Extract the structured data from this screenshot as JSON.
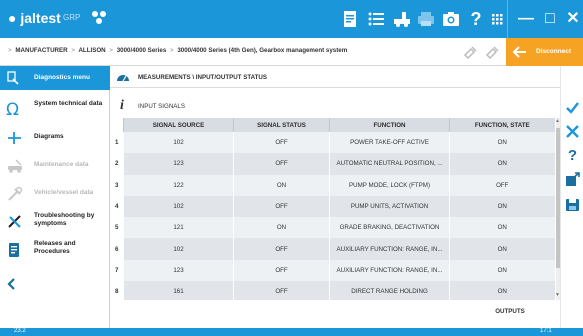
{
  "app": {
    "logo_text": "jaltest",
    "logo_sub": "GRP"
  },
  "toolbar": {
    "icons": [
      "report-icon",
      "list-icon",
      "truck-icon",
      "printer-icon",
      "camera-icon",
      "help-icon",
      "apps-grid-icon"
    ],
    "window_buttons": {
      "minimize": "—",
      "maximize": "□",
      "close": "✕"
    }
  },
  "breadcrumb": {
    "items": [
      "MANUFACTURER",
      "ALLISON",
      "3000/4000 Series",
      "3000/4000 Series (4th Gen), Gearbox management system"
    ],
    "separator": ">"
  },
  "disconnect": {
    "label": "Disconnect"
  },
  "sidebar": {
    "header": "Diagnostics menu",
    "items": [
      {
        "label": "System technical data",
        "icon": "omega-icon",
        "enabled": true
      },
      {
        "label": "Diagrams",
        "icon": "diagram-icon",
        "enabled": true
      },
      {
        "label": "Maintenance data",
        "icon": "wrench-car-icon",
        "enabled": false
      },
      {
        "label": "Vehicle/vessel data",
        "icon": "tools-icon",
        "enabled": false
      },
      {
        "label": "Troubleshooting by symptoms",
        "icon": "troubleshoot-icon",
        "enabled": true
      },
      {
        "label": "Releases and Procedures",
        "icon": "procedures-icon",
        "enabled": true
      }
    ]
  },
  "main": {
    "title": "MEASUREMENTS \\ INPUT/OUTPUT STATUS",
    "section": {
      "icon_glyph": "i",
      "label": "INPUT SIGNALS"
    },
    "table": {
      "headers": [
        "SIGNAL SOURCE",
        "SIGNAL STATUS",
        "FUNCTION",
        "FUNCTION, STATE"
      ],
      "rows": [
        {
          "num": "1",
          "source": "102",
          "status": "OFF",
          "function": "POWER TAKE-OFF ACTIVE",
          "state": "ON"
        },
        {
          "num": "2",
          "source": "123",
          "status": "OFF",
          "function": "AUTOMATIC NEUTRAL POSITION, ...",
          "state": "ON"
        },
        {
          "num": "3",
          "source": "122",
          "status": "ON",
          "function": "PUMP MODE, LOCK (FTPM)",
          "state": "OFF"
        },
        {
          "num": "4",
          "source": "102",
          "status": "OFF",
          "function": "PUMP UNITS, ACTIVATION",
          "state": "ON"
        },
        {
          "num": "5",
          "source": "121",
          "status": "ON",
          "function": "GRADE BRAKING, DEACTIVATION",
          "state": "ON"
        },
        {
          "num": "6",
          "source": "102",
          "status": "OFF",
          "function": "AUXILIARY FUNCTION: RANGE, IN...",
          "state": "ON"
        },
        {
          "num": "7",
          "source": "123",
          "status": "OFF",
          "function": "AUXILIARY FUNCTION: RANGE, IN...",
          "state": "ON"
        },
        {
          "num": "8",
          "source": "161",
          "status": "OFF",
          "function": "DIRECT RANGE HOLDING",
          "state": "ON"
        }
      ]
    },
    "outputs_label": "OUTPUTS"
  },
  "rightbar": {
    "buttons": [
      "check-icon",
      "close-icon",
      "help-question-icon",
      "export-icon",
      "save-icon"
    ]
  },
  "statusbar": {
    "left_text": "23.2",
    "right_text": "17:1"
  },
  "colors": {
    "primary": "#1a96d9",
    "accent": "#f6a323",
    "header_gray": "#d8dde3"
  }
}
